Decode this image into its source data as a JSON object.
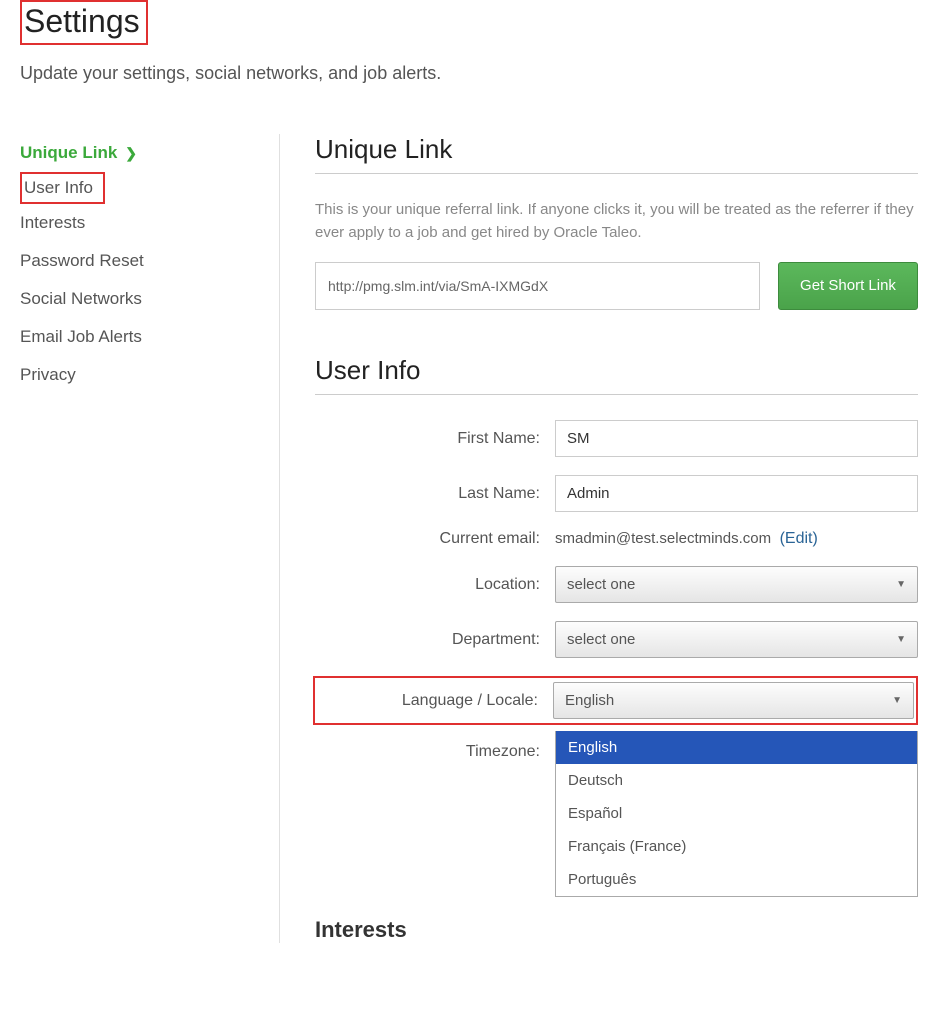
{
  "header": {
    "title": "Settings",
    "subtitle": "Update your settings, social networks, and job alerts."
  },
  "sidebar": {
    "items": [
      {
        "label": "Unique Link",
        "active": true
      },
      {
        "label": "User Info",
        "highlighted": true
      },
      {
        "label": "Interests"
      },
      {
        "label": "Password Reset"
      },
      {
        "label": "Social Networks"
      },
      {
        "label": "Email Job Alerts"
      },
      {
        "label": "Privacy"
      }
    ]
  },
  "unique_link": {
    "title": "Unique Link",
    "description": "This is your unique referral link. If anyone clicks it, you will be treated as the referrer if they ever apply to a job and get hired by Oracle Taleo.",
    "value": "http://pmg.slm.int/via/SmA-IXMGdX",
    "button_label": "Get Short Link"
  },
  "user_info": {
    "title": "User Info",
    "fields": {
      "first_name": {
        "label": "First Name:",
        "value": "SM"
      },
      "last_name": {
        "label": "Last Name:",
        "value": "Admin"
      },
      "email": {
        "label": "Current email:",
        "value": "smadmin@test.selectminds.com",
        "edit_label": "(Edit)"
      },
      "location": {
        "label": "Location:",
        "value": "select one"
      },
      "department": {
        "label": "Department:",
        "value": "select one"
      },
      "language": {
        "label": "Language / Locale:",
        "value": "English",
        "options": [
          "English",
          "Deutsch",
          "Español",
          "Français (France)",
          "Português"
        ]
      },
      "timezone": {
        "label": "Timezone:"
      }
    }
  },
  "interests_section": {
    "title": "Interests"
  }
}
